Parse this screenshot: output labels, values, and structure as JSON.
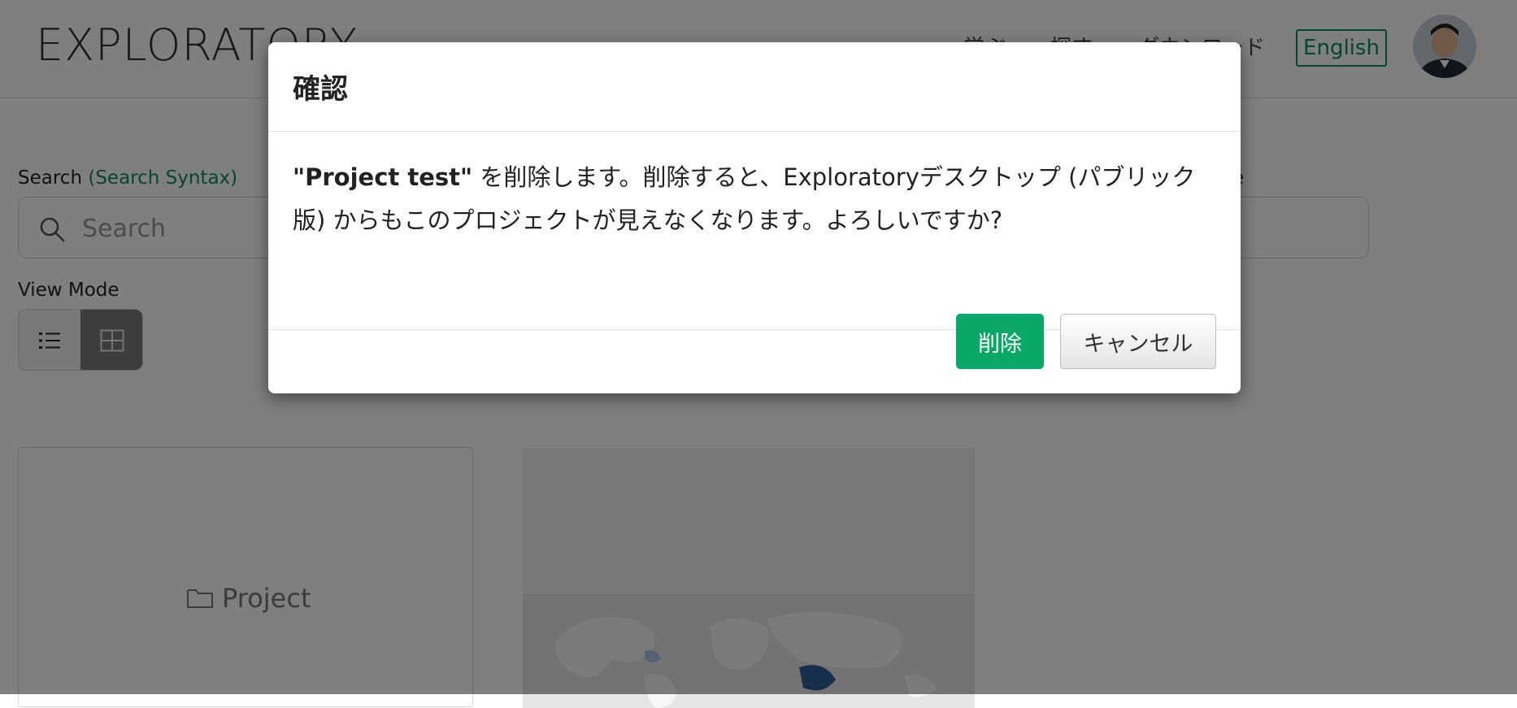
{
  "header": {
    "logo": "EXPLORATORY",
    "nav": [
      "学ぶ",
      "探す",
      "ダウンロード"
    ],
    "language_button": "English"
  },
  "search": {
    "label": "Search",
    "syntax_link": "(Search Syntax)",
    "placeholder": "Search",
    "right_label_fragment": "e"
  },
  "view_mode": {
    "label": "View Mode",
    "options": [
      "list",
      "grid"
    ],
    "selected": "grid"
  },
  "cards": [
    {
      "type": "project",
      "label": "Project"
    },
    {
      "type": "map-thumbnail"
    }
  ],
  "modal": {
    "title": "確認",
    "message_project_name": "\"Project test\"",
    "message_text": " を削除します。削除すると、Exploratoryデスクトップ (パブリック版) からもこのプロジェクトが見えなくなります。よろしいですか?",
    "delete_button": "削除",
    "cancel_button": "キャンセル"
  },
  "colors": {
    "accent": "#0aa866",
    "link": "#0a8f56",
    "overlay": "rgba(0,0,0,0.5)"
  }
}
